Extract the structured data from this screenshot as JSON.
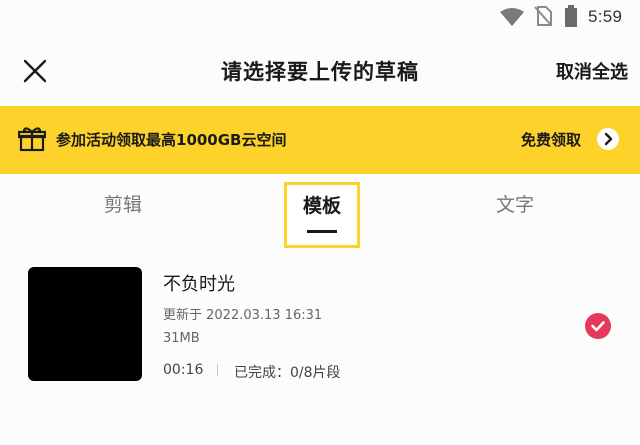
{
  "status_bar": {
    "time": "5:59",
    "icons": [
      "wifi-icon",
      "no-sim-icon",
      "battery-icon"
    ]
  },
  "header": {
    "close_icon": "close-icon",
    "title": "请选择要上传的草稿",
    "cancel_all": "取消全选"
  },
  "banner": {
    "icon": "gift-icon",
    "text": "参加活动领取最高1000GB云空间",
    "action": "免费领取",
    "action_icon": "chevron-right-icon",
    "background": "#fdd22a"
  },
  "tabs": [
    {
      "label": "剪辑",
      "selected": false
    },
    {
      "label": "模板",
      "selected": true
    },
    {
      "label": "文字",
      "selected": false
    }
  ],
  "drafts": [
    {
      "name": "不负时光",
      "updated": "更新于 2022.03.13 16:31",
      "size": "31MB",
      "duration": "00:16",
      "progress": "已完成：0/8片段",
      "selected": true,
      "check_color": "#e5385c"
    }
  ],
  "colors": {
    "accent": "#fdd22a",
    "selected_check": "#e5385c",
    "text_primary": "#1a1a1a",
    "text_secondary": "#666666"
  }
}
